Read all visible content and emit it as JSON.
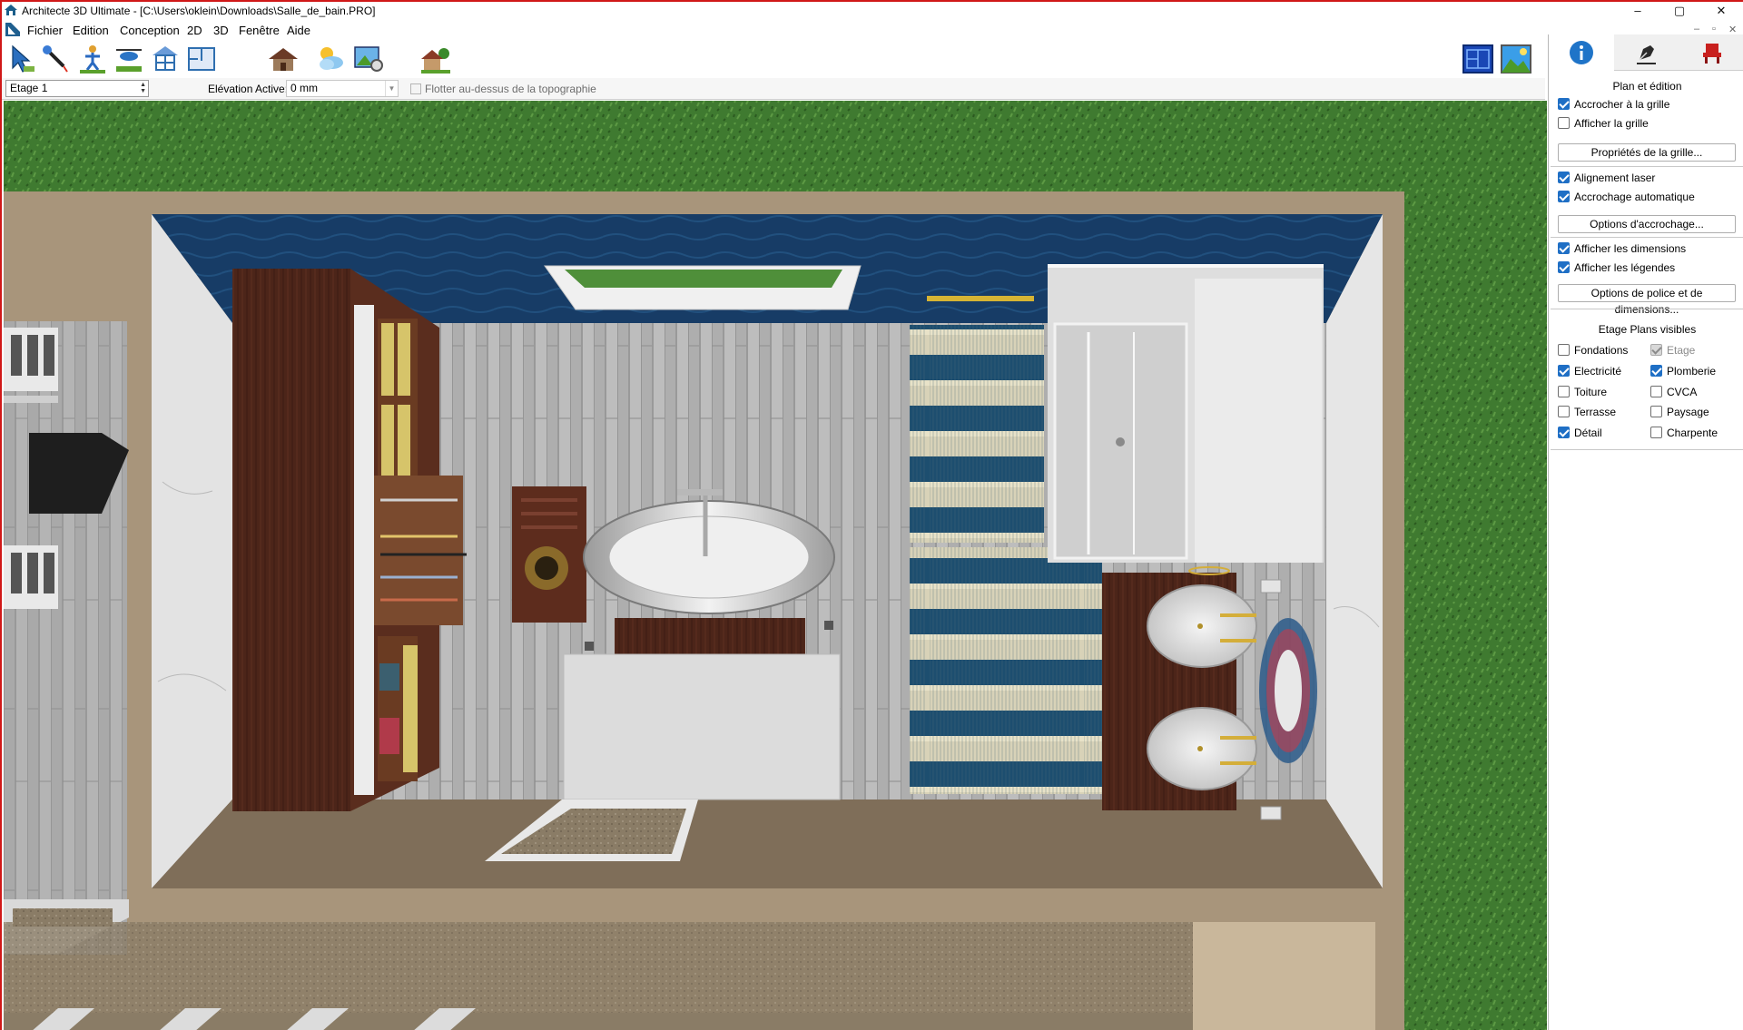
{
  "window": {
    "title": "Architecte 3D Ultimate - [C:\\Users\\oklein\\Downloads\\Salle_de_bain.PRO]",
    "controls": [
      "–",
      "▢",
      "✕"
    ]
  },
  "menu": {
    "items": [
      "Fichier",
      "Edition",
      "Conception",
      "2D",
      "3D",
      "Fenêtre",
      "Aide"
    ],
    "mdi_controls": [
      "–",
      "▫",
      "✕"
    ]
  },
  "toolbar": {
    "tools": [
      "selection-arrow-icon",
      "eyedropper-icon",
      "walkthrough-person-icon",
      "aerial-helicopter-icon",
      "building-structure-icon",
      "floor-plan-icon",
      "house-icon",
      "weather-sun-cloud-icon",
      "render-settings-icon",
      "landscape-house-icon"
    ],
    "view_buttons": [
      "2d-plan-view-icon",
      "3d-landscape-view-icon"
    ]
  },
  "levelbar": {
    "level": "Etage 1",
    "elevation_label": "Elévation Active:",
    "elevation_value": "0 mm",
    "float_label": "Flotter au-dessus de la topographie",
    "float_checked": false
  },
  "panel": {
    "tabs": [
      "info-icon",
      "pen-icon",
      "chair-icon"
    ],
    "title": "Plan et édition",
    "snap_to_grid": "Accrocher à la grille",
    "show_grid": "Afficher la grille",
    "grid_props": "Propriétés de la grille...",
    "laser_align": "Alignement laser",
    "auto_snap": "Accrochage automatique",
    "snap_options": "Options d'accrochage...",
    "show_dims": "Afficher les dimensions",
    "show_legends": "Afficher les légendes",
    "font_options": "Options de police et de dimensions...",
    "plans_title": "Etage Plans visibles",
    "plans": {
      "fondations": "Fondations",
      "etage": "Etage",
      "electricite": "Electricité",
      "plomberie": "Plomberie",
      "toiture": "Toiture",
      "cvca": "CVCA",
      "terrasse": "Terrasse",
      "paysage": "Paysage",
      "detail": "Détail",
      "charpente": "Charpente"
    },
    "states": {
      "snap_to_grid": true,
      "show_grid": false,
      "laser_align": true,
      "auto_snap": true,
      "show_dims": true,
      "show_legends": true,
      "fondations": false,
      "etage": true,
      "electricite": true,
      "plomberie": true,
      "toiture": false,
      "cvca": false,
      "terrasse": false,
      "paysage": false,
      "detail": true,
      "charpente": false
    }
  },
  "scene": {
    "colors": {
      "grass": "#3f7a30",
      "wall_top": "#a8957b",
      "floor_planks": "#b8b8b8",
      "blue_wall": "#163a64",
      "wood_dark": "#4a2418",
      "rug_blue": "#1c4a68",
      "marble": "#e6e6e6"
    }
  }
}
